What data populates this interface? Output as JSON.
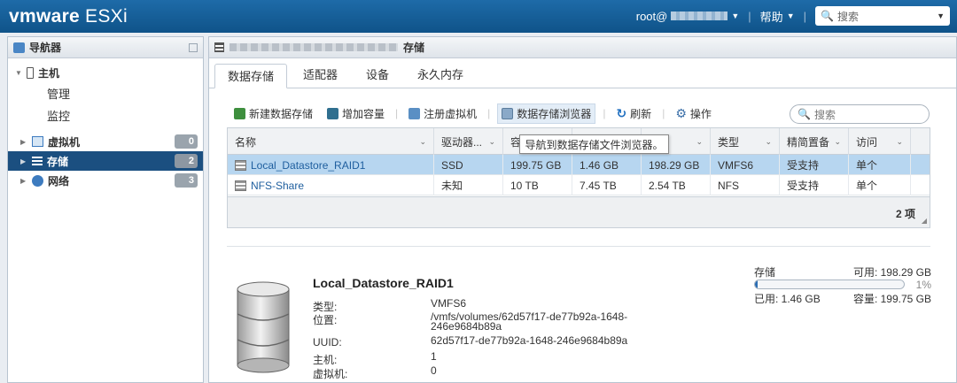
{
  "topbar": {
    "brand": "vmware",
    "product": "ESXi",
    "user_prefix": "root@",
    "help_label": "帮助",
    "search_placeholder": "搜索"
  },
  "navigator": {
    "title": "导航器",
    "host_label": "主机",
    "host_children": [
      "管理",
      "监控"
    ],
    "items": [
      {
        "label": "虚拟机",
        "count": "0"
      },
      {
        "label": "存储",
        "count": "2"
      },
      {
        "label": "网络",
        "count": "3"
      }
    ]
  },
  "main": {
    "header_suffix": "存储",
    "tabs": [
      "数据存储",
      "适配器",
      "设备",
      "永久内存"
    ],
    "toolbar": {
      "new_datastore": "新建数据存储",
      "increase_capacity": "增加容量",
      "register_vm": "注册虚拟机",
      "datastore_browser": "数据存储浏览器",
      "refresh": "刷新",
      "actions": "操作"
    },
    "search_placeholder": "搜索",
    "tooltip": "导航到数据存储文件浏览器。",
    "table": {
      "columns": [
        "名称",
        "驱动器...",
        "容",
        "",
        "",
        "类型",
        "精简置备",
        "访问"
      ],
      "rows": [
        {
          "name": "Local_Datastore_RAID1",
          "drive": "SSD",
          "capacity": "199.75 GB",
          "provisioned": "1.46 GB",
          "free": "198.29 GB",
          "type": "VMFS6",
          "thin": "受支持",
          "access": "单个"
        },
        {
          "name": "NFS-Share",
          "drive": "未知",
          "capacity": "10 TB",
          "provisioned": "7.45 TB",
          "free": "2.54 TB",
          "type": "NFS",
          "thin": "受支持",
          "access": "单个"
        }
      ],
      "count_label": "2 项"
    },
    "details": {
      "title": "Local_Datastore_RAID1",
      "type_label": "类型:",
      "type_value": "VMFS6",
      "location_label": "位置:",
      "location_value": "/vmfs/volumes/62d57f17-de77b92a-1648-246e9684b89a",
      "uuid_label": "UUID:",
      "uuid_value": "62d57f17-de77b92a-1648-246e9684b89a",
      "host_label": "主机:",
      "host_value": "1",
      "vm_label": "虚拟机:",
      "vm_value": "0",
      "storage_label": "存储",
      "available": "可用: 198.29 GB",
      "used_pct": "1%",
      "used_fraction": 0.01,
      "used": "已用: 1.46 GB",
      "capacity": "容量: 199.75 GB"
    }
  },
  "colors": {
    "topbar": "#0f5389",
    "selected_nav": "#1b4f80",
    "selected_row": "#b7d6f0",
    "link": "#1e5e9e"
  }
}
